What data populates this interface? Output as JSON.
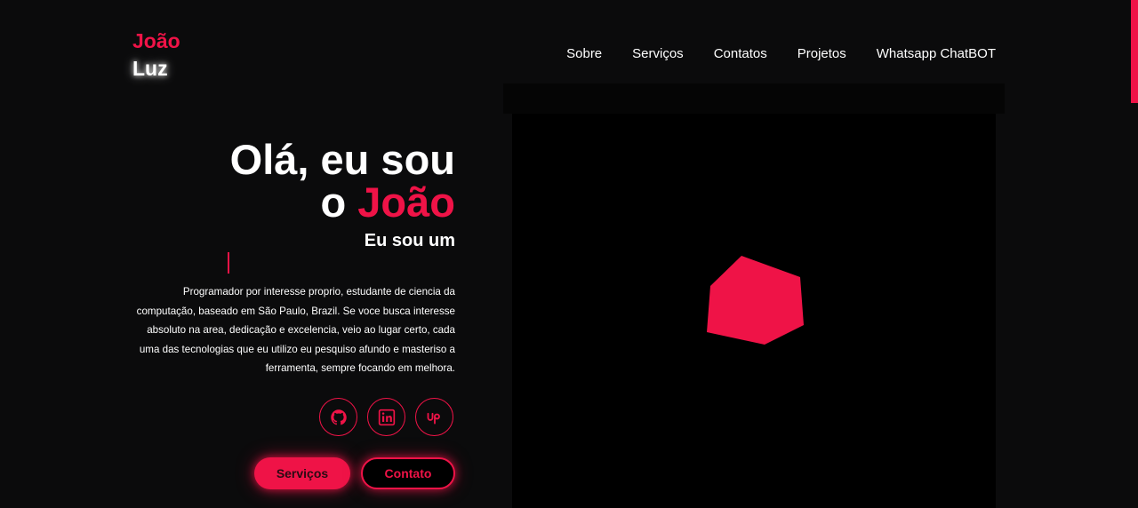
{
  "logo": {
    "line1": "João",
    "line2": "Luz"
  },
  "nav": {
    "items": [
      {
        "label": "Sobre"
      },
      {
        "label": "Serviços"
      },
      {
        "label": "Contatos"
      },
      {
        "label": "Projetos"
      },
      {
        "label": "Whatsapp ChatBOT"
      }
    ]
  },
  "hero": {
    "line1": "Olá, eu sou",
    "line2_prefix": "o ",
    "line2_name": "João",
    "subtitle": "Eu sou um",
    "bio": "Programador por interesse proprio, estudante de ciencia da computação, baseado em São Paulo, Brazil. Se voce busca interesse absoluto na area, dedicação e excelencia, veio ao lugar certo, cada uma das tecnologias que eu utilizo eu pesquiso afundo e masteriso a ferramenta, sempre focando em melhora."
  },
  "socials": [
    {
      "icon": "github-icon"
    },
    {
      "icon": "linkedin-icon"
    },
    {
      "icon": "upwork-icon"
    }
  ],
  "buttons": {
    "services": "Serviços",
    "contact": "Contato"
  },
  "colors": {
    "accent": "#ef1347",
    "background": "#0b0b0c",
    "stage": "#000000"
  }
}
